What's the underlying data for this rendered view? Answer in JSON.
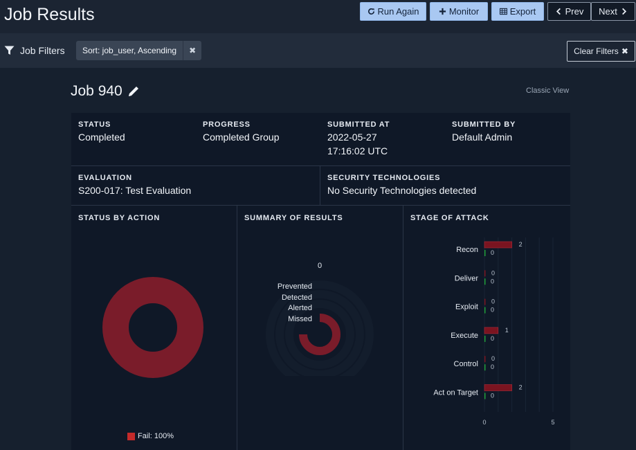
{
  "header": {
    "title": "Job Results",
    "buttons": {
      "run_again": "Run Again",
      "monitor": "Monitor",
      "export": "Export",
      "prev": "Prev",
      "next": "Next"
    }
  },
  "filters": {
    "label": "Job Filters",
    "chip": "Sort: job_user, Ascending",
    "clear": "Clear Filters"
  },
  "job": {
    "title": "Job 940",
    "classic_view": "Classic View",
    "status_label": "STATUS",
    "status": "Completed",
    "progress_label": "PROGRESS",
    "progress": "Completed Group",
    "submitted_at_label": "SUBMITTED AT",
    "submitted_date": "2022-05-27",
    "submitted_time": "17:16:02 UTC",
    "submitted_by_label": "SUBMITTED BY",
    "submitted_by": "Default Admin",
    "evaluation_label": "EVALUATION",
    "evaluation": "S200-017: Test Evaluation",
    "security_label": "SECURITY TECHNOLOGIES",
    "security": "No Security Technologies detected"
  },
  "status_by_action": {
    "title": "STATUS BY ACTION",
    "legend": "Fail: 100%",
    "color": "#7a1c2a"
  },
  "summary_of_results": {
    "title": "SUMMARY OF RESULTS",
    "center_value": "0",
    "labels": [
      "Prevented",
      "Detected",
      "Alerted",
      "Missed"
    ]
  },
  "stage_of_attack": {
    "title": "STAGE OF ATTACK",
    "axis_ticks": [
      "0",
      "5"
    ]
  },
  "chart_data": {
    "type": "bar",
    "title": "STAGE OF ATTACK",
    "categories": [
      "Recon",
      "Deliver",
      "Exploit",
      "Execute",
      "Control",
      "Act on Target"
    ],
    "series": [
      {
        "values": [
          2,
          0,
          0,
          1,
          0,
          2
        ],
        "color": "#7a1420"
      },
      {
        "values": [
          0,
          0,
          0,
          0,
          0,
          0
        ],
        "color": "#1f9e3a"
      }
    ],
    "xlim": [
      0,
      5
    ]
  }
}
